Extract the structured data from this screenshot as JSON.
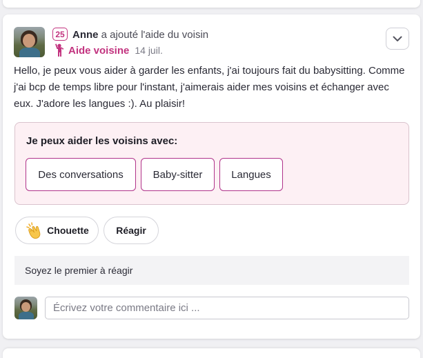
{
  "post": {
    "level": "25",
    "author": "Anne",
    "action": " a ajouté l'aide du voisin",
    "type_label": "Aide voisine",
    "date": "14 juil.",
    "type_icon": "person-raising-hand-icon",
    "body": "Hello, je peux vous aider à garder les enfants, j'ai toujours fait du babysitting. Comme j'ai bcp de temps libre pour l'instant, j'aimerais aider mes voisins et échanger avec eux. J'adore les langues :). Au plaisir!"
  },
  "help_box": {
    "title": "Je peux aider les voisins avec:",
    "items": [
      "Des conversations",
      "Baby-sitter",
      "Langues"
    ]
  },
  "reactions": {
    "chouette_label": "Chouette",
    "reagir_label": "Réagir",
    "empty_text": "Soyez le premier à réagir"
  },
  "comment": {
    "placeholder": "Écrivez votre commentaire ici ..."
  },
  "colors": {
    "accent": "#c2337f",
    "chip_border": "#b0338a",
    "help_box_bg": "#fdf0f4"
  }
}
